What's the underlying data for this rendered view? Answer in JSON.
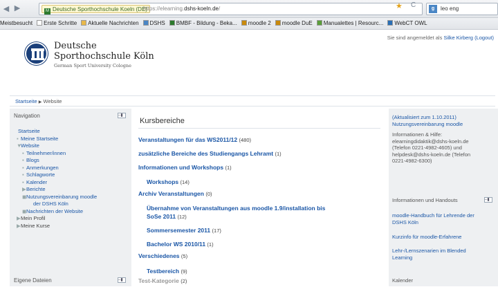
{
  "browser": {
    "site_identity": "Deutsche Sporthochschule Koeln (DE)",
    "url_prefix": "https://elearning.",
    "url_domain": "dshs-koeln.de",
    "url_suffix": "/",
    "search_text": "leo eng"
  },
  "bookmarks": [
    "Meistbesucht",
    "Erste Schritte",
    "Aktuelle Nachrichten",
    "DSHS",
    "BMBF - Bildung - Beka...",
    "moodle 2",
    "moodle DuE",
    "Manualettes | Resourc...",
    "WebCT OWL"
  ],
  "header": {
    "logo_line1": "Deutsche",
    "logo_line2": "Sporthochschule Köln",
    "logo_tagline": "German Sport University Cologne",
    "login_prefix": "Sie sind angemeldet als ",
    "login_user": "Silke Kirberg",
    "login_logout": "(Logout)"
  },
  "breadcrumb": {
    "home": "Startseite",
    "separator": "▶",
    "current": "Website"
  },
  "navigation": {
    "title": "Navigation",
    "collapse": "–▮",
    "items": [
      {
        "label": "Startseite",
        "type": "link",
        "prefix": ""
      },
      {
        "label": "Meine Startseite",
        "type": "link",
        "prefix": "▪"
      },
      {
        "label": "Website",
        "type": "link",
        "prefix": "▼"
      },
      {
        "label": "Teilnehmer/innen",
        "type": "link",
        "prefix": "▪"
      },
      {
        "label": "Blogs",
        "type": "link",
        "prefix": "▪"
      },
      {
        "label": "Anmerkungen",
        "type": "link",
        "prefix": "▪"
      },
      {
        "label": "Schlagworte",
        "type": "link",
        "prefix": "▪"
      },
      {
        "label": "Kalender",
        "type": "link",
        "prefix": "▪"
      },
      {
        "label": "Berichte",
        "type": "link",
        "prefix": "▶"
      },
      {
        "label": "Nutzungsvereinbarung moodle",
        "type": "link",
        "prefix": "◼"
      },
      {
        "label": "der DSHS Köln",
        "type": "link",
        "prefix": ""
      },
      {
        "label": "Nachrichten der Website",
        "type": "link",
        "prefix": "◼"
      },
      {
        "label": "Mein Profil",
        "type": "plain",
        "prefix": "▶"
      },
      {
        "label": "Meine Kurse",
        "type": "plain",
        "prefix": "▶"
      }
    ],
    "files_title": "Eigene Dateien"
  },
  "main": {
    "title": "Kursbereiche",
    "categories": [
      {
        "label": "Veranstaltungen für das WS2011/12",
        "count": "(480)"
      },
      {
        "label": "zusätzliche Bereiche des Studiengangs Lehramt",
        "count": "(1)"
      },
      {
        "label": "Informationen und Workshops",
        "count": "(1)"
      },
      {
        "label": "Workshops",
        "count": "(14)"
      },
      {
        "label": "Archiv Veranstaltungen",
        "count": "(0)"
      },
      {
        "label": "Übernahme von Veranstaltungen aus moodle 1.9/installation bis",
        "count": ""
      },
      {
        "label": "SoSe 2011",
        "count": "(12)"
      },
      {
        "label": "Sommersemester 2011",
        "count": "(17)"
      },
      {
        "label": "Bachelor WS 2010/11",
        "count": "(1)"
      },
      {
        "label": "Verschiedenes",
        "count": "(5)"
      },
      {
        "label": "Testbereich",
        "count": "(9)"
      },
      {
        "label": "Test-Kategorie",
        "count": "(2)"
      }
    ]
  },
  "right": {
    "notice_l1": "(Aktualisiert zum 1.10.2011)",
    "notice_l2": "Nutzungsvereinbarung moodle",
    "help_l1": "Informationen & Hilfe:",
    "help_l2": "elearningdidaktik@dshs-koeln.de",
    "help_l3": "(Telefon 0221-4982-4605) und",
    "help_l4": "helpdesk@dshs-koeln.de (Telefon",
    "help_l5": "0221-4982-6300)",
    "handouts_title": "Informationen und Handouts",
    "link1_l1": "moodle-Handbuch für Lehrende der",
    "link1_l2": "DSHS Köln",
    "link2": "Kurzinfo für moodle-Erfahrene",
    "link3_l1": "Lehr-/Lernszenarien im Blended",
    "link3_l2": "Learning",
    "calendar_title": "Kalender"
  }
}
